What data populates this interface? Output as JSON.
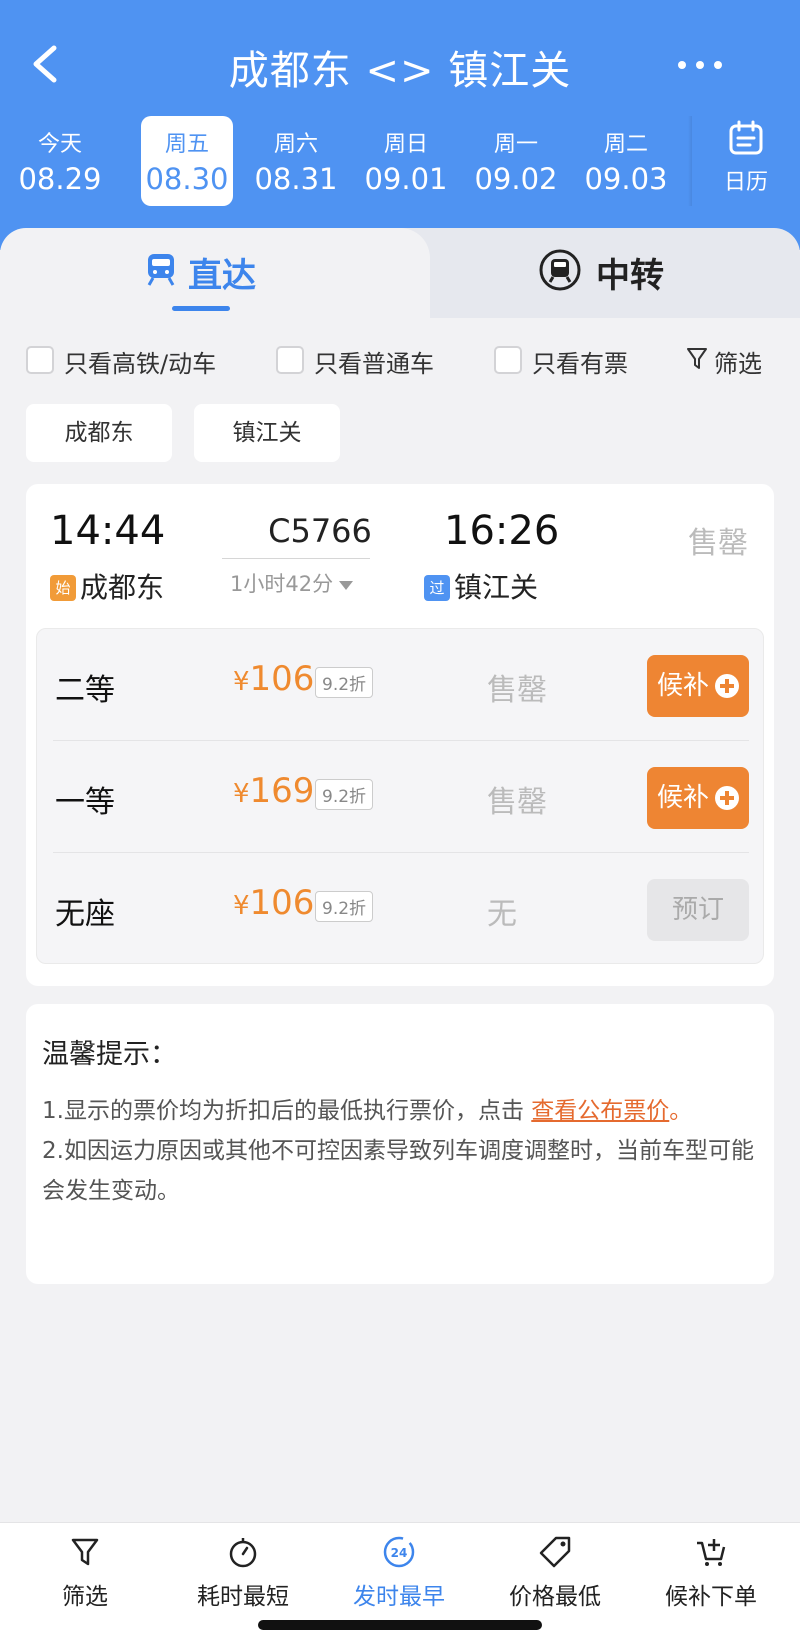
{
  "header": {
    "title": "成都东 <> 镇江关",
    "dates": [
      {
        "weekday": "今天",
        "date": "08.29",
        "active": false
      },
      {
        "weekday": "周五",
        "date": "08.30",
        "active": true
      },
      {
        "weekday": "周六",
        "date": "08.31",
        "active": false
      },
      {
        "weekday": "周日",
        "date": "09.01",
        "active": false
      },
      {
        "weekday": "周一",
        "date": "09.02",
        "active": false
      },
      {
        "weekday": "周二",
        "date": "09.03",
        "active": false
      }
    ],
    "calendar_label": "日历"
  },
  "tabs": {
    "direct": "直达",
    "transfer": "中转"
  },
  "filters": {
    "high_speed": "只看高铁/动车",
    "regular": "只看普通车",
    "available": "只看有票",
    "filter_label": "筛选"
  },
  "stations": {
    "from": "成都东",
    "to": "镇江关"
  },
  "train": {
    "dep_time": "14:44",
    "arr_time": "16:26",
    "number": "C5766",
    "duration": "1小时42分",
    "dep_station": "成都东",
    "arr_station": "镇江关",
    "dep_tag": "始",
    "arr_tag": "过",
    "status": "售罄",
    "seats": [
      {
        "name": "二等",
        "price": "106",
        "discount": "9.2折",
        "availability": "售罄",
        "action": "候补"
      },
      {
        "name": "一等",
        "price": "169",
        "discount": "9.2折",
        "availability": "售罄",
        "action": "候补"
      },
      {
        "name": "无座",
        "price": "106",
        "discount": "9.2折",
        "availability": "无",
        "action": "预订"
      }
    ],
    "currency": "¥"
  },
  "notice": {
    "title": "温馨提示：",
    "line1_prefix": "1.显示的票价均为折扣后的最低执行票价，点击 ",
    "line1_link": "查看公布票价",
    "line1_suffix": "。",
    "line2": "2.如因运力原因或其他不可控因素导致列车调度调整时，当前车型可能会发生变动。"
  },
  "bottom_bar": {
    "filter": "筛选",
    "shortest": "耗时最短",
    "earliest": "发时最早",
    "cheapest": "价格最低",
    "waitlist": "候补下单",
    "earliest_badge": "24"
  },
  "colors": {
    "header_blue": "#4f93f2",
    "accent_blue": "#3d85ec",
    "price_orange": "#ef8a2f",
    "wait_button": "#ee8533"
  }
}
